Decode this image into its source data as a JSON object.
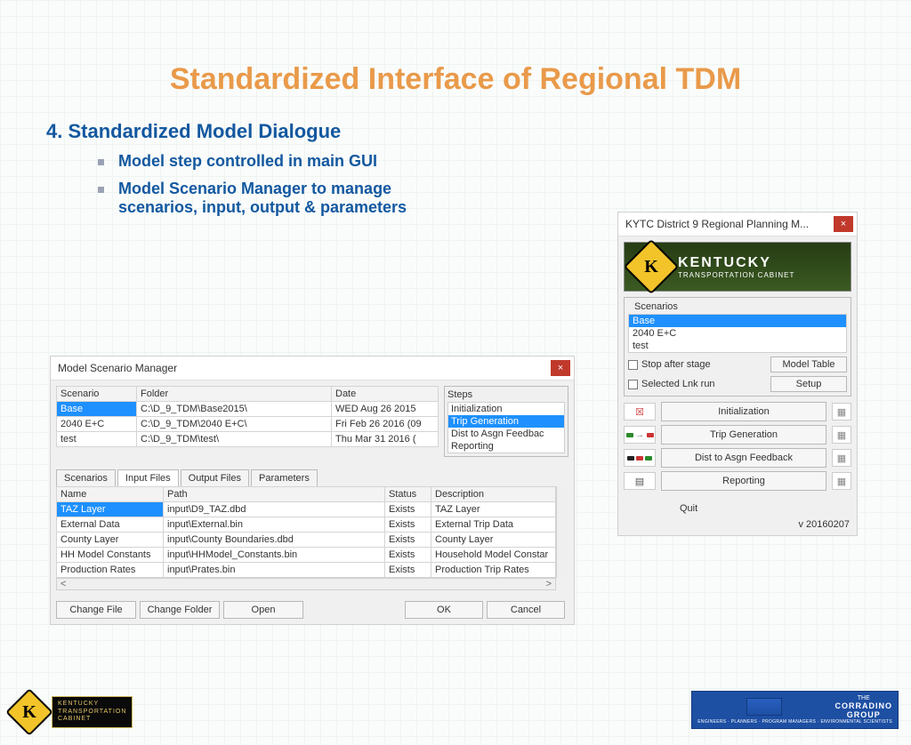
{
  "slide": {
    "title": "Standardized Interface of Regional TDM",
    "section": "4. Standardized Model Dialogue",
    "bullets": [
      "Model step controlled in main GUI",
      "Model Scenario Manager to manage scenarios, input, output & parameters"
    ]
  },
  "msm": {
    "title": "Model Scenario Manager",
    "close": "×",
    "cols": {
      "scenario": "Scenario",
      "folder": "Folder",
      "date": "Date"
    },
    "rows": [
      {
        "scenario": "Base",
        "folder": "C:\\D_9_TDM\\Base2015\\",
        "date": "WED Aug 26 2015"
      },
      {
        "scenario": "2040 E+C",
        "folder": "C:\\D_9_TDM\\2040 E+C\\",
        "date": "Fri Feb 26 2016 (09"
      },
      {
        "scenario": "test",
        "folder": "C:\\D_9_TDM\\test\\",
        "date": "Thu Mar 31 2016 ("
      }
    ],
    "steps_label": "Steps",
    "steps": [
      "Initialization",
      "Trip Generation",
      "Dist to Asgn Feedbac",
      "Reporting"
    ],
    "tabs": [
      "Scenarios",
      "Input Files",
      "Output Files",
      "Parameters"
    ],
    "filecols": {
      "name": "Name",
      "path": "Path",
      "status": "Status",
      "desc": "Description"
    },
    "files": [
      {
        "name": "TAZ Layer",
        "path": "input\\D9_TAZ.dbd",
        "status": "Exists",
        "desc": "TAZ Layer"
      },
      {
        "name": "External Data",
        "path": "input\\External.bin",
        "status": "Exists",
        "desc": "External Trip Data"
      },
      {
        "name": "County Layer",
        "path": "input\\County Boundaries.dbd",
        "status": "Exists",
        "desc": "County Layer"
      },
      {
        "name": "HH Model Constants",
        "path": "input\\HHModel_Constants.bin",
        "status": "Exists",
        "desc": "Household Model Constar"
      },
      {
        "name": "Production Rates",
        "path": "input\\Prates.bin",
        "status": "Exists",
        "desc": "Production Trip Rates"
      }
    ],
    "scroll": {
      "left": "<",
      "right": ">"
    },
    "buttons": {
      "change_file": "Change File",
      "change_folder": "Change Folder",
      "open": "Open",
      "ok": "OK",
      "cancel": "Cancel"
    }
  },
  "d9": {
    "title": "KYTC District 9 Regional Planning M...",
    "close": "×",
    "banner": {
      "line1": "KENTUCKY",
      "line2": "TRANSPORTATION CABINET"
    },
    "scen_label": "Scenarios",
    "scenarios": [
      "Base",
      "2040 E+C",
      "test"
    ],
    "stop_after": "Stop after stage",
    "sel_lnk": "Selected Lnk run",
    "model_table": "Model Table",
    "setup": "Setup",
    "steps": [
      "Initialization",
      "Trip Generation",
      "Dist to Asgn Feedback",
      "Reporting"
    ],
    "quit": "Quit",
    "version": "v 20160207"
  },
  "footer": {
    "plate_l1": "KENTUCKY",
    "plate_l2": "TRANSPORTATION",
    "plate_l3": "CABINET",
    "corr_t0": "THE",
    "corr_t1": "CORRADINO",
    "corr_t2": "GROUP",
    "corr_sub": "ENGINEERS · PLANNERS · PROGRAM MANAGERS · ENVIRONMENTAL SCIENTISTS"
  }
}
